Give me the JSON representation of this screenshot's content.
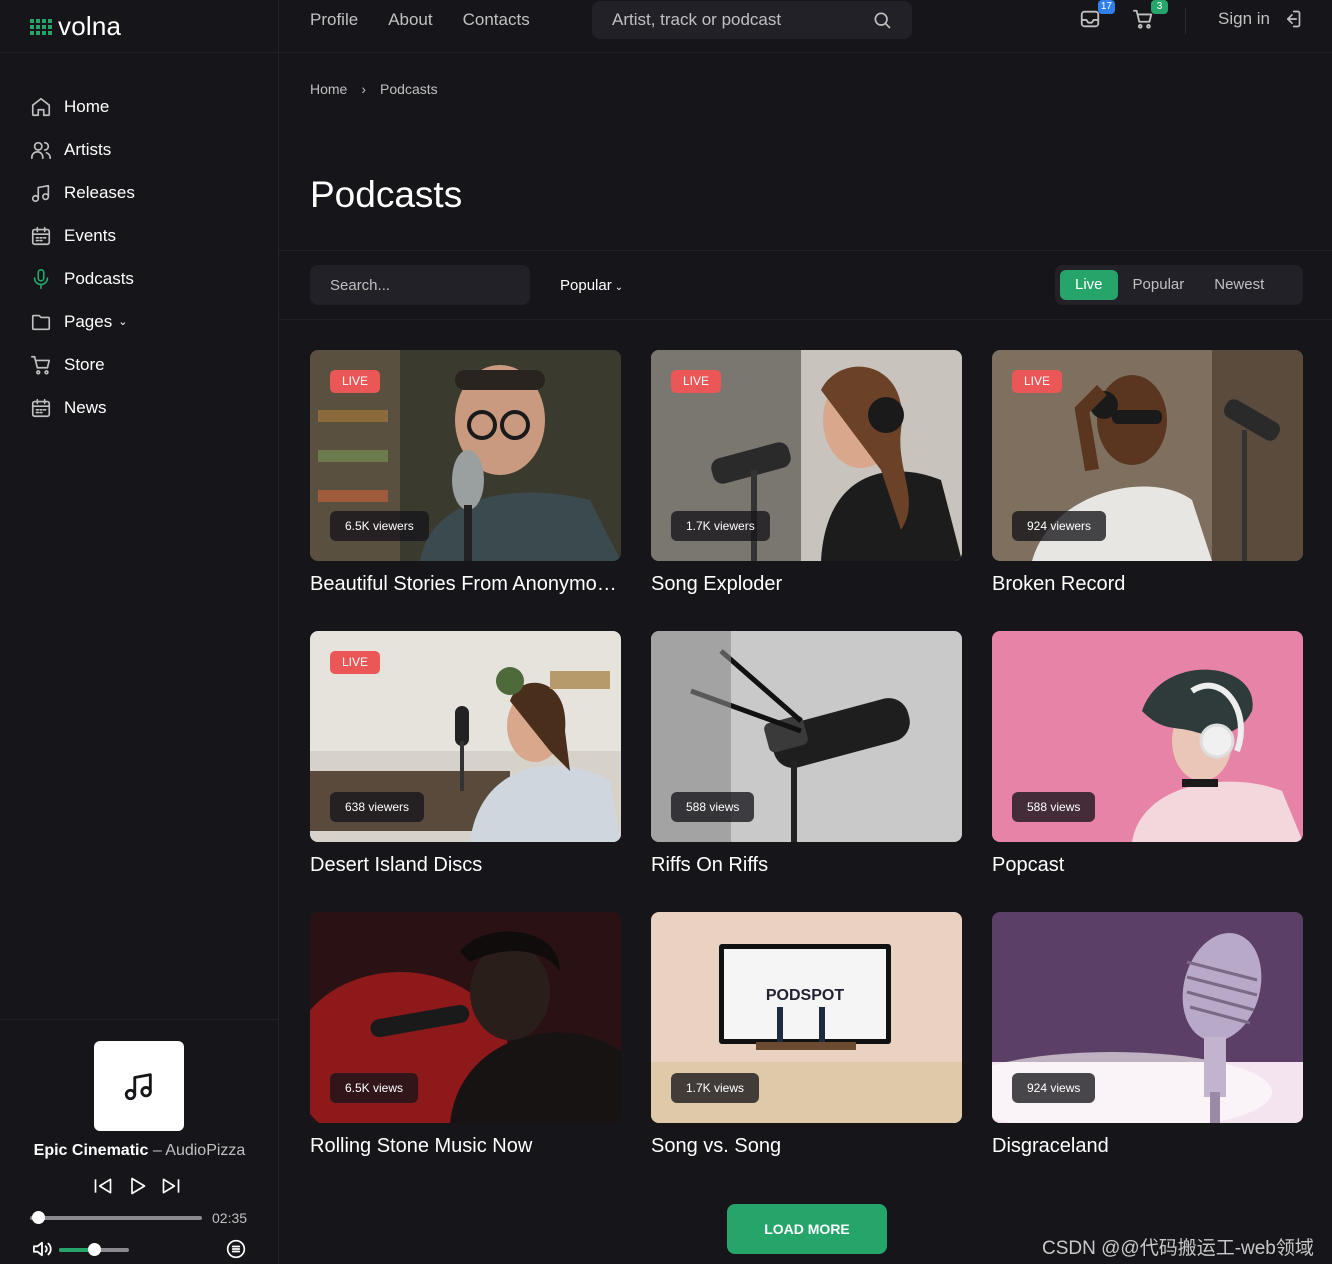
{
  "app": {
    "name": "volna",
    "brand_color": "#25a56a",
    "bg_color": "#16151a",
    "panel_color": "#222127"
  },
  "sidebar": {
    "items": [
      {
        "label": "Home",
        "icon": "home-icon"
      },
      {
        "label": "Artists",
        "icon": "users-icon"
      },
      {
        "label": "Releases",
        "icon": "music-note-icon"
      },
      {
        "label": "Events",
        "icon": "calendar-icon"
      },
      {
        "label": "Podcasts",
        "icon": "microphone-icon",
        "active": true
      },
      {
        "label": "Pages",
        "icon": "folder-icon",
        "has_dropdown": true
      },
      {
        "label": "Store",
        "icon": "cart-icon"
      },
      {
        "label": "News",
        "icon": "calendar-icon"
      }
    ]
  },
  "header": {
    "nav": [
      "Profile",
      "About",
      "Contacts"
    ],
    "search_placeholder": "Artist, track or podcast",
    "inbox_count": "17",
    "cart_count": "3",
    "signin_label": "Sign in"
  },
  "breadcrumb": {
    "home": "Home",
    "current": "Podcasts"
  },
  "page_title": "Podcasts",
  "filters": {
    "search_placeholder": "Search...",
    "sort_label": "Popular",
    "tabs": [
      {
        "label": "Live",
        "active": true
      },
      {
        "label": "Popular",
        "active": false
      },
      {
        "label": "Newest",
        "active": false
      }
    ]
  },
  "podcasts": [
    {
      "title": "Beautiful Stories From Anonymous People",
      "count": "6.5K viewers",
      "live": true
    },
    {
      "title": "Song Exploder",
      "count": "1.7K viewers",
      "live": true
    },
    {
      "title": "Broken Record",
      "count": "924 viewers",
      "live": true
    },
    {
      "title": "Desert Island Discs",
      "count": "638 viewers",
      "live": true
    },
    {
      "title": "Riffs On Riffs",
      "count": "588 views",
      "live": false
    },
    {
      "title": "Popcast",
      "count": "588 views",
      "live": false
    },
    {
      "title": "Rolling Stone Music Now",
      "count": "6.5K views",
      "live": false
    },
    {
      "title": "Song vs. Song",
      "count": "1.7K views",
      "live": false
    },
    {
      "title": "Disgraceland",
      "count": "924 views",
      "live": false
    }
  ],
  "live_badge_label": "LIVE",
  "load_more_label": "LOAD MORE",
  "player": {
    "track_title": "Epic Cinematic",
    "separator": "–",
    "artist": "AudioPizza",
    "time": "02:35",
    "progress": 0.02,
    "volume": 0.5
  },
  "watermark": "CSDN @@代码搬运工-web领域"
}
